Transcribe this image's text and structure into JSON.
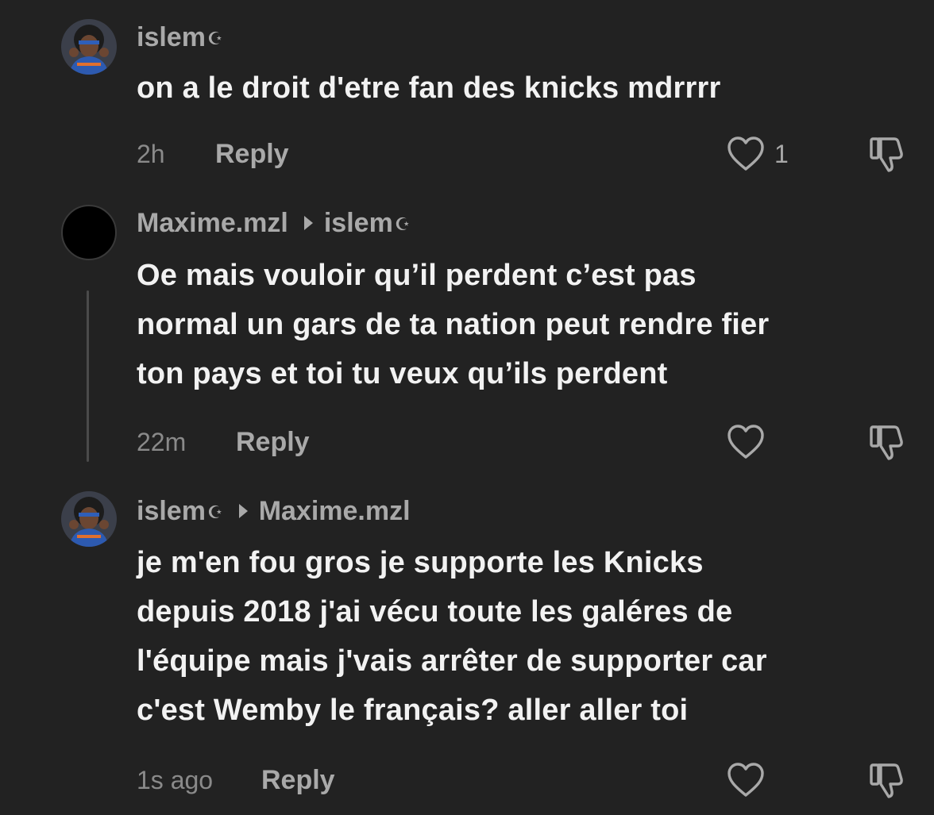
{
  "colors": {
    "background": "#222222",
    "primary_text": "#f2f2f2",
    "secondary_text": "#a9a9a9",
    "muted_text": "#8a8a8a",
    "thread_line": "#4a4a4a"
  },
  "comments": [
    {
      "author": "islem",
      "author_badge_icon": "crescent-star-icon",
      "reply_to": "",
      "text": "on a le droit d'etre fan des knicks mdrrrr",
      "time": "2h",
      "reply_label": "Reply",
      "like_count": "1"
    },
    {
      "author": "Maxime.mzl",
      "reply_to": "islem",
      "reply_to_badge_icon": "crescent-star-icon",
      "text": "Oe mais vouloir qu’il perdent c’est pas\nnormal un gars de ta nation peut rendre fier\nton pays et toi tu veux qu’ils perdent",
      "time": "22m",
      "reply_label": "Reply",
      "like_count": ""
    },
    {
      "author": "islem",
      "author_badge_icon": "crescent-star-icon",
      "reply_to": "Maxime.mzl",
      "text": "je m'en fou gros je supporte les Knicks\ndepuis 2018 j'ai vécu toute les galéres de\nl'équipe mais j'vais arrêter de supporter car\nc'est Wemby le français? aller aller toi",
      "time": "1s ago",
      "reply_label": "Reply",
      "like_count": ""
    }
  ]
}
